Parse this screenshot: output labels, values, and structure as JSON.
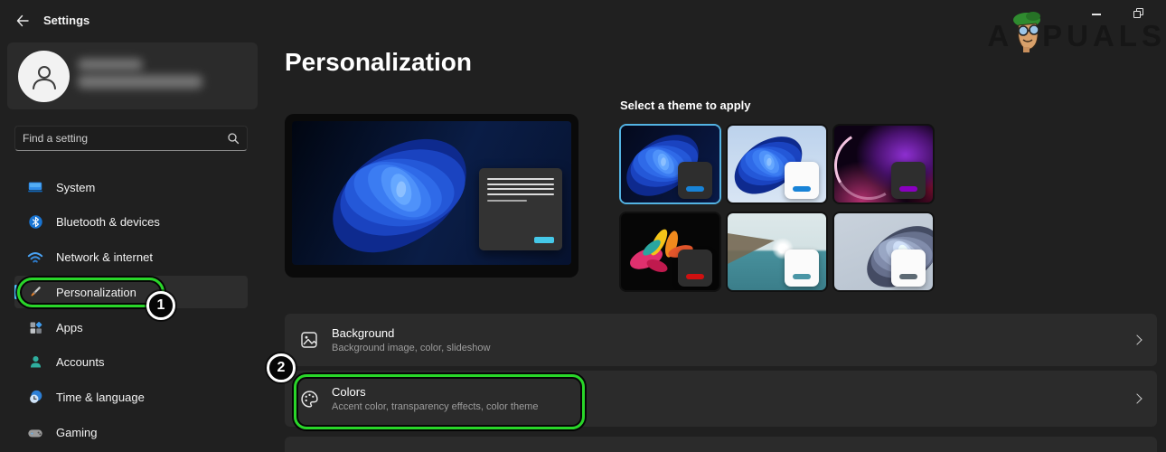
{
  "window": {
    "title": "Settings",
    "watermark_left": "A",
    "watermark_right": "PUALS",
    "controls": {
      "minimize": "minimize",
      "restore": "restore"
    }
  },
  "sidebar": {
    "search_placeholder": "Find a setting",
    "items": [
      {
        "label": "System",
        "icon": "system-icon",
        "selected": false
      },
      {
        "label": "Bluetooth & devices",
        "icon": "bluetooth-icon",
        "selected": false
      },
      {
        "label": "Network & internet",
        "icon": "network-icon",
        "selected": false
      },
      {
        "label": "Personalization",
        "icon": "personalization-icon",
        "selected": true
      },
      {
        "label": "Apps",
        "icon": "apps-icon",
        "selected": false
      },
      {
        "label": "Accounts",
        "icon": "accounts-icon",
        "selected": false
      },
      {
        "label": "Time & language",
        "icon": "time-language-icon",
        "selected": false
      },
      {
        "label": "Gaming",
        "icon": "gaming-icon",
        "selected": false
      }
    ]
  },
  "main": {
    "title": "Personalization",
    "themes": {
      "title": "Select a theme to apply",
      "items": [
        {
          "selected": true,
          "card": "dark",
          "accent": "#1883d7"
        },
        {
          "selected": false,
          "card": "light",
          "accent": "#1883d7"
        },
        {
          "selected": false,
          "card": "dark",
          "accent": "#8a00c0"
        },
        {
          "selected": false,
          "card": "dark",
          "accent": "#cf1010"
        },
        {
          "selected": false,
          "card": "light",
          "accent": "#4a96a6"
        },
        {
          "selected": false,
          "card": "light",
          "accent": "#5d6a74"
        }
      ]
    },
    "rows": [
      {
        "title": "Background",
        "subtitle": "Background image, color, slideshow",
        "icon": "background-image-icon"
      },
      {
        "title": "Colors",
        "subtitle": "Accent color, transparency effects, color theme",
        "icon": "color-palette-icon"
      }
    ]
  },
  "annotations": {
    "highlight_color": "#29d629",
    "steps": [
      {
        "label": "1"
      },
      {
        "label": "2"
      }
    ]
  },
  "colors": {
    "accent": "#4cc2ff",
    "selected_theme_border": "#53b3e3",
    "hero_accent_pill": "#45c8e8",
    "page_bg": "#202020",
    "card_bg": "#2b2b2b"
  }
}
